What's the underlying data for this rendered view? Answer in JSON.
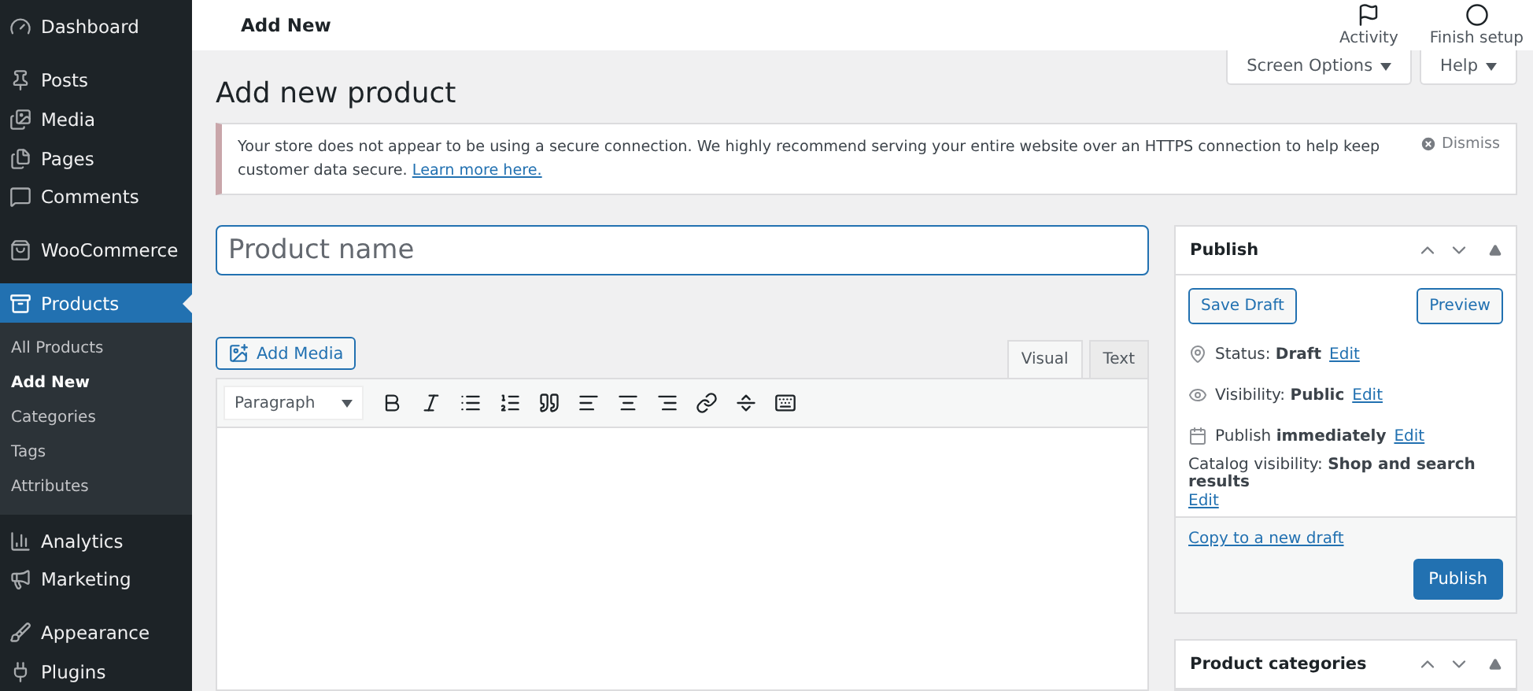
{
  "sidebar": {
    "items": [
      {
        "label": "Dashboard",
        "selected": false
      },
      {
        "label": "Posts",
        "selected": false
      },
      {
        "label": "Media",
        "selected": false
      },
      {
        "label": "Pages",
        "selected": false
      },
      {
        "label": "Comments",
        "selected": false
      },
      {
        "label": "WooCommerce",
        "selected": false
      },
      {
        "label": "Products",
        "selected": true,
        "children": [
          {
            "label": "All Products",
            "selected": false
          },
          {
            "label": "Add New",
            "selected": true
          },
          {
            "label": "Categories",
            "selected": false
          },
          {
            "label": "Tags",
            "selected": false
          },
          {
            "label": "Attributes",
            "selected": false
          }
        ]
      },
      {
        "label": "Analytics",
        "selected": false
      },
      {
        "label": "Marketing",
        "selected": false
      },
      {
        "label": "Appearance",
        "selected": false
      },
      {
        "label": "Plugins",
        "selected": false
      }
    ]
  },
  "topbar": {
    "title": "Add New",
    "actions": [
      {
        "label": "Activity"
      },
      {
        "label": "Finish setup"
      }
    ]
  },
  "screen_tabs": [
    "Screen Options",
    "Help"
  ],
  "page_title": "Add new product",
  "notice": {
    "text": "Your store does not appear to be using a secure connection. We highly recommend serving your entire website over an HTTPS connection to help keep customer data secure.",
    "link": "Learn more here.",
    "dismiss": "Dismiss"
  },
  "product_name": {
    "placeholder": "Product name"
  },
  "editor": {
    "add_media": "Add Media",
    "tabs": [
      {
        "label": "Visual",
        "selected": true
      },
      {
        "label": "Text",
        "selected": false
      }
    ],
    "format": "Paragraph"
  },
  "publish": {
    "title": "Publish",
    "save_draft": "Save Draft",
    "preview": "Preview",
    "rows": [
      {
        "kind": "status",
        "text": "Status: **Draft**",
        "link": "Edit"
      },
      {
        "kind": "visibility",
        "text": "Visibility: **Public**",
        "link": "Edit"
      },
      {
        "kind": "schedule",
        "text": "Publish **immediately**",
        "link": "Edit"
      },
      {
        "kind": "catalog",
        "text": "Catalog visibility: **Shop and search results**",
        "link": "Edit"
      }
    ],
    "copy_link": "Copy to a new draft",
    "publish_button": "Publish"
  },
  "categories_box": {
    "title": "Product categories"
  }
}
